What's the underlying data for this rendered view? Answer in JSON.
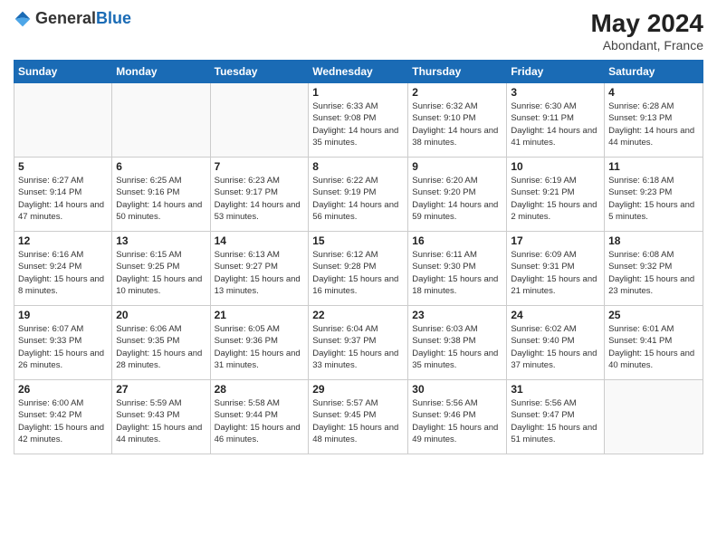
{
  "header": {
    "logo_general": "General",
    "logo_blue": "Blue",
    "month_year": "May 2024",
    "location": "Abondant, France"
  },
  "days_of_week": [
    "Sunday",
    "Monday",
    "Tuesday",
    "Wednesday",
    "Thursday",
    "Friday",
    "Saturday"
  ],
  "weeks": [
    [
      {
        "num": "",
        "info": ""
      },
      {
        "num": "",
        "info": ""
      },
      {
        "num": "",
        "info": ""
      },
      {
        "num": "1",
        "info": "Sunrise: 6:33 AM\nSunset: 9:08 PM\nDaylight: 14 hours and 35 minutes."
      },
      {
        "num": "2",
        "info": "Sunrise: 6:32 AM\nSunset: 9:10 PM\nDaylight: 14 hours and 38 minutes."
      },
      {
        "num": "3",
        "info": "Sunrise: 6:30 AM\nSunset: 9:11 PM\nDaylight: 14 hours and 41 minutes."
      },
      {
        "num": "4",
        "info": "Sunrise: 6:28 AM\nSunset: 9:13 PM\nDaylight: 14 hours and 44 minutes."
      }
    ],
    [
      {
        "num": "5",
        "info": "Sunrise: 6:27 AM\nSunset: 9:14 PM\nDaylight: 14 hours and 47 minutes."
      },
      {
        "num": "6",
        "info": "Sunrise: 6:25 AM\nSunset: 9:16 PM\nDaylight: 14 hours and 50 minutes."
      },
      {
        "num": "7",
        "info": "Sunrise: 6:23 AM\nSunset: 9:17 PM\nDaylight: 14 hours and 53 minutes."
      },
      {
        "num": "8",
        "info": "Sunrise: 6:22 AM\nSunset: 9:19 PM\nDaylight: 14 hours and 56 minutes."
      },
      {
        "num": "9",
        "info": "Sunrise: 6:20 AM\nSunset: 9:20 PM\nDaylight: 14 hours and 59 minutes."
      },
      {
        "num": "10",
        "info": "Sunrise: 6:19 AM\nSunset: 9:21 PM\nDaylight: 15 hours and 2 minutes."
      },
      {
        "num": "11",
        "info": "Sunrise: 6:18 AM\nSunset: 9:23 PM\nDaylight: 15 hours and 5 minutes."
      }
    ],
    [
      {
        "num": "12",
        "info": "Sunrise: 6:16 AM\nSunset: 9:24 PM\nDaylight: 15 hours and 8 minutes."
      },
      {
        "num": "13",
        "info": "Sunrise: 6:15 AM\nSunset: 9:25 PM\nDaylight: 15 hours and 10 minutes."
      },
      {
        "num": "14",
        "info": "Sunrise: 6:13 AM\nSunset: 9:27 PM\nDaylight: 15 hours and 13 minutes."
      },
      {
        "num": "15",
        "info": "Sunrise: 6:12 AM\nSunset: 9:28 PM\nDaylight: 15 hours and 16 minutes."
      },
      {
        "num": "16",
        "info": "Sunrise: 6:11 AM\nSunset: 9:30 PM\nDaylight: 15 hours and 18 minutes."
      },
      {
        "num": "17",
        "info": "Sunrise: 6:09 AM\nSunset: 9:31 PM\nDaylight: 15 hours and 21 minutes."
      },
      {
        "num": "18",
        "info": "Sunrise: 6:08 AM\nSunset: 9:32 PM\nDaylight: 15 hours and 23 minutes."
      }
    ],
    [
      {
        "num": "19",
        "info": "Sunrise: 6:07 AM\nSunset: 9:33 PM\nDaylight: 15 hours and 26 minutes."
      },
      {
        "num": "20",
        "info": "Sunrise: 6:06 AM\nSunset: 9:35 PM\nDaylight: 15 hours and 28 minutes."
      },
      {
        "num": "21",
        "info": "Sunrise: 6:05 AM\nSunset: 9:36 PM\nDaylight: 15 hours and 31 minutes."
      },
      {
        "num": "22",
        "info": "Sunrise: 6:04 AM\nSunset: 9:37 PM\nDaylight: 15 hours and 33 minutes."
      },
      {
        "num": "23",
        "info": "Sunrise: 6:03 AM\nSunset: 9:38 PM\nDaylight: 15 hours and 35 minutes."
      },
      {
        "num": "24",
        "info": "Sunrise: 6:02 AM\nSunset: 9:40 PM\nDaylight: 15 hours and 37 minutes."
      },
      {
        "num": "25",
        "info": "Sunrise: 6:01 AM\nSunset: 9:41 PM\nDaylight: 15 hours and 40 minutes."
      }
    ],
    [
      {
        "num": "26",
        "info": "Sunrise: 6:00 AM\nSunset: 9:42 PM\nDaylight: 15 hours and 42 minutes."
      },
      {
        "num": "27",
        "info": "Sunrise: 5:59 AM\nSunset: 9:43 PM\nDaylight: 15 hours and 44 minutes."
      },
      {
        "num": "28",
        "info": "Sunrise: 5:58 AM\nSunset: 9:44 PM\nDaylight: 15 hours and 46 minutes."
      },
      {
        "num": "29",
        "info": "Sunrise: 5:57 AM\nSunset: 9:45 PM\nDaylight: 15 hours and 48 minutes."
      },
      {
        "num": "30",
        "info": "Sunrise: 5:56 AM\nSunset: 9:46 PM\nDaylight: 15 hours and 49 minutes."
      },
      {
        "num": "31",
        "info": "Sunrise: 5:56 AM\nSunset: 9:47 PM\nDaylight: 15 hours and 51 minutes."
      },
      {
        "num": "",
        "info": ""
      }
    ]
  ]
}
